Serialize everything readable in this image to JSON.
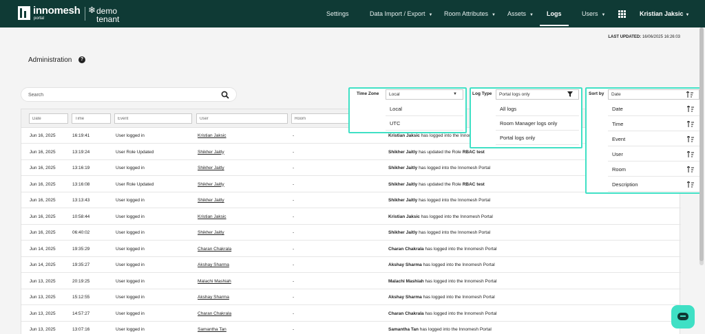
{
  "brand": {
    "name": "innomesh",
    "sub": "portal",
    "tenant": "demo\ntenant"
  },
  "nav": {
    "items": [
      {
        "label": "Settings",
        "caret": false
      },
      {
        "label": "Data Import / Export",
        "caret": true
      },
      {
        "label": "Room Attributes",
        "caret": true
      },
      {
        "label": "Assets",
        "caret": true
      },
      {
        "label": "Logs",
        "caret": false,
        "active": true
      },
      {
        "label": "Users",
        "caret": true
      }
    ],
    "user": "Kristian Jaksic"
  },
  "last_updated": {
    "label": "LAST UPDATED:",
    "value": "16/06/2025 16:26:03"
  },
  "page_title": "Administration",
  "search": {
    "placeholder": "Search"
  },
  "filters": {
    "date": "Date",
    "time": "Time",
    "event": "Event",
    "user": "User",
    "room": "Room"
  },
  "time_zone": {
    "label": "Time Zone",
    "selected": "Local",
    "options": [
      "Local",
      "UTC"
    ]
  },
  "log_type": {
    "label": "Log Type",
    "selected": "Portal logs only",
    "options": [
      "All logs",
      "Room Manager logs only",
      "Portal logs only"
    ]
  },
  "sort_by": {
    "label": "Sort by",
    "selected": "Date",
    "options": [
      "Date",
      "Time",
      "Event",
      "User",
      "Room",
      "Description"
    ]
  },
  "rows": [
    {
      "date": "Jun 16, 2025",
      "time": "16:19:41",
      "event": "User logged in",
      "user": "Kristian Jaksic",
      "room": "-",
      "desc_name": "Kristian Jaksic",
      "desc_text": " has logged into the Innomesh Portal",
      "desc_extra": ""
    },
    {
      "date": "Jun 16, 2025",
      "time": "13:19:24",
      "event": "User Role Updated",
      "user": "Shikher Jaitly",
      "room": "-",
      "desc_name": "Shikher Jaitly",
      "desc_text": " has updated the Role ",
      "desc_extra": "RBAC test"
    },
    {
      "date": "Jun 16, 2025",
      "time": "13:16:19",
      "event": "User logged in",
      "user": "Shikher Jaitly",
      "room": "-",
      "desc_name": "Shikher Jaitly",
      "desc_text": " has logged into the Innomesh Portal",
      "desc_extra": ""
    },
    {
      "date": "Jun 16, 2025",
      "time": "13:16:08",
      "event": "User Role Updated",
      "user": "Shikher Jaitly",
      "room": "-",
      "desc_name": "Shikher Jaitly",
      "desc_text": " has updated the Role ",
      "desc_extra": "RBAC test"
    },
    {
      "date": "Jun 16, 2025",
      "time": "13:13:43",
      "event": "User logged in",
      "user": "Shikher Jaitly",
      "room": "-",
      "desc_name": "Shikher Jaitly",
      "desc_text": " has logged into the Innomesh Portal",
      "desc_extra": ""
    },
    {
      "date": "Jun 16, 2025",
      "time": "10:58:44",
      "event": "User logged in",
      "user": "Kristian Jaksic",
      "room": "-",
      "desc_name": "Kristian Jaksic",
      "desc_text": " has logged into the Innomesh Portal",
      "desc_extra": ""
    },
    {
      "date": "Jun 16, 2025",
      "time": "06:40:02",
      "event": "User logged in",
      "user": "Shikher Jaitly",
      "room": "-",
      "desc_name": "Shikher Jaitly",
      "desc_text": " has logged into the Innomesh Portal",
      "desc_extra": ""
    },
    {
      "date": "Jun 14, 2025",
      "time": "19:35:29",
      "event": "User logged in",
      "user": "Charan Chakrala",
      "room": "-",
      "desc_name": "Charan Chakrala",
      "desc_text": " has logged into the Innomesh Portal",
      "desc_extra": ""
    },
    {
      "date": "Jun 14, 2025",
      "time": "19:35:27",
      "event": "User logged in",
      "user": "Akshay Sharma",
      "room": "-",
      "desc_name": "Akshay Sharma",
      "desc_text": " has logged into the Innomesh Portal",
      "desc_extra": ""
    },
    {
      "date": "Jun 13, 2025",
      "time": "20:19:25",
      "event": "User logged in",
      "user": "Malachi Mashiah",
      "room": "-",
      "desc_name": "Malachi Mashiah",
      "desc_text": " has logged into the Innomesh Portal",
      "desc_extra": ""
    },
    {
      "date": "Jun 13, 2025",
      "time": "15:12:55",
      "event": "User logged in",
      "user": "Akshay Sharma",
      "room": "-",
      "desc_name": "Akshay Sharma",
      "desc_text": " has logged into the Innomesh Portal",
      "desc_extra": ""
    },
    {
      "date": "Jun 13, 2025",
      "time": "14:57:27",
      "event": "User logged in",
      "user": "Charan Chakrala",
      "room": "-",
      "desc_name": "Charan Chakrala",
      "desc_text": " has logged into the Innomesh Portal",
      "desc_extra": ""
    },
    {
      "date": "Jun 13, 2025",
      "time": "13:07:16",
      "event": "User logged in",
      "user": "Samantha Tan",
      "room": "-",
      "desc_name": "Samantha Tan",
      "desc_text": " has logged into the Innomesh Portal",
      "desc_extra": ""
    }
  ],
  "colors": {
    "nav_bg": "#0f3a35",
    "accent": "#3fe0c5"
  }
}
